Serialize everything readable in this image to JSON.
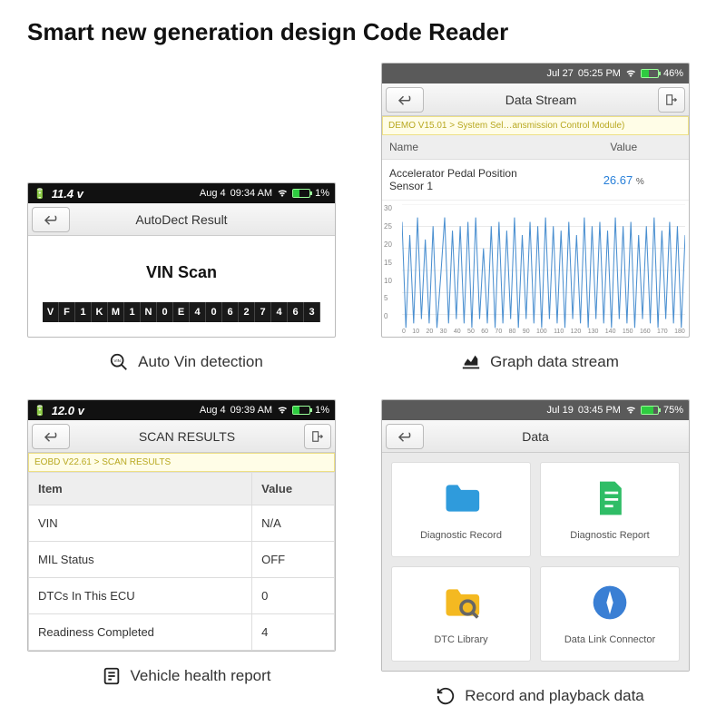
{
  "headline": "Smart new generation design Code Reader",
  "panel1": {
    "status": {
      "voltage": "11.4 v",
      "date": "Aug 4",
      "time": "09:34 AM",
      "battery_pct": "1%"
    },
    "title": "AutoDect Result",
    "vin_label": "VIN Scan",
    "vin": [
      "V",
      "F",
      "1",
      "K",
      "M",
      "1",
      "N",
      "0",
      "E",
      "4",
      "0",
      "6",
      "2",
      "7",
      "4",
      "6",
      "3"
    ],
    "caption": "Auto Vin detection"
  },
  "panel2": {
    "status": {
      "date": "Jul 27",
      "time": "05:25 PM",
      "battery_pct": "46%"
    },
    "title": "Data Stream",
    "breadcrumb": "DEMO V15.01 > System Sel…ansmission Control Module)",
    "columns": {
      "name": "Name",
      "value": "Value"
    },
    "row": {
      "name": "Accelerator Pedal Position Sensor 1",
      "value": "26.67",
      "unit": "%"
    },
    "chart_data": {
      "type": "line",
      "title": "",
      "xlabel": "",
      "ylabel": "",
      "ylim": [
        0,
        30
      ],
      "xlim": [
        0,
        180
      ],
      "y_ticks": [
        "30",
        "25",
        "20",
        "15",
        "10",
        "5",
        "0"
      ],
      "x_ticks": [
        "0",
        "10",
        "20",
        "30",
        "40",
        "50",
        "60",
        "70",
        "80",
        "90",
        "100",
        "110",
        "120",
        "130",
        "140",
        "150",
        "160",
        "170",
        "180"
      ],
      "values": [
        26,
        2,
        23,
        3,
        27,
        4,
        22,
        3,
        25,
        2,
        14,
        27,
        3,
        24,
        4,
        25,
        3,
        26,
        2,
        27,
        4,
        20,
        3,
        25,
        2,
        26,
        3,
        24,
        4,
        27,
        2,
        23,
        4,
        26,
        3,
        25,
        2,
        27,
        4,
        25,
        3,
        24,
        2,
        26,
        4,
        23,
        3,
        27,
        2,
        25,
        4,
        26,
        3,
        24,
        2,
        27,
        4,
        25,
        3,
        26,
        2,
        23,
        4,
        25,
        3,
        27,
        2,
        24,
        4,
        26,
        3,
        25,
        2,
        23
      ]
    },
    "caption": "Graph data stream"
  },
  "panel3": {
    "status": {
      "voltage": "12.0 v",
      "date": "Aug 4",
      "time": "09:39 AM",
      "battery_pct": "1%"
    },
    "title": "SCAN RESULTS",
    "breadcrumb": "EOBD V22.61 > SCAN RESULTS",
    "columns": {
      "item": "Item",
      "value": "Value"
    },
    "rows": [
      {
        "item": "VIN",
        "value": "N/A"
      },
      {
        "item": "MIL Status",
        "value": "OFF"
      },
      {
        "item": "DTCs In This ECU",
        "value": "0"
      },
      {
        "item": "Readiness Completed",
        "value": "4"
      }
    ],
    "caption": "Vehicle health report"
  },
  "panel4": {
    "status": {
      "date": "Jul 19",
      "time": "03:45 PM",
      "battery_pct": "75%"
    },
    "title": "Data",
    "tiles": [
      {
        "label": "Diagnostic Record",
        "icon": "folder",
        "color": "#2f9bdc"
      },
      {
        "label": "Diagnostic Report",
        "icon": "report",
        "color": "#2fbd66"
      },
      {
        "label": "DTC Library",
        "icon": "search-folder",
        "color": "#f4b921"
      },
      {
        "label": "Data Link Connector",
        "icon": "compass",
        "color": "#3a7fd4"
      }
    ],
    "caption": "Record and playback data"
  }
}
